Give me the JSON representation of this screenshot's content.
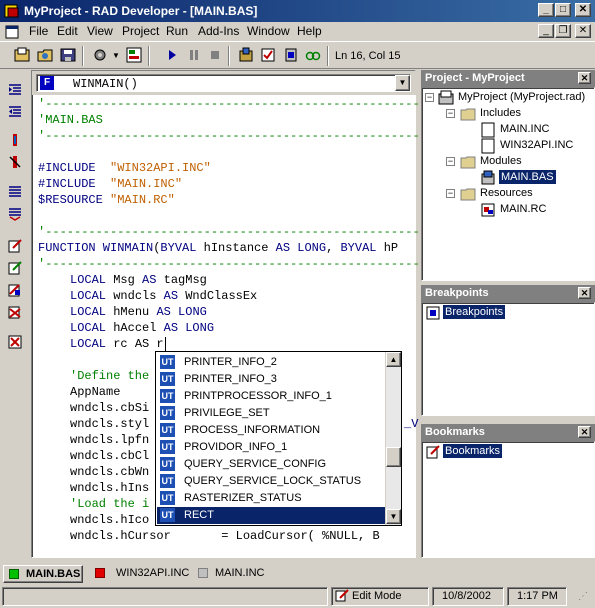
{
  "window": {
    "title": "MyProject - RAD Developer - [MAIN.BAS]"
  },
  "menu": [
    "File",
    "Edit",
    "View",
    "Project",
    "Run",
    "Add-Ins",
    "Window",
    "Help"
  ],
  "toolbar": {
    "position_text": "Ln 16, Col 15"
  },
  "editor": {
    "procedure": "WINMAIN()",
    "dash_line": "'-----------------------------------------------------------------",
    "file_comment": "'MAIN.BAS",
    "includes": [
      {
        "directive": "#INCLUDE",
        "file": "\"WIN32API.INC\""
      },
      {
        "directive": "#INCLUDE",
        "file": "\"MAIN.INC\""
      },
      {
        "directive": "$RESOURCE",
        "file": "\"MAIN.RC\""
      }
    ],
    "function_line": {
      "kw1": "FUNCTION WINMAIN",
      "p1": "(",
      "kw2": "BYVAL",
      "p2": " hInstance ",
      "kw3": "AS LONG",
      "p3": ", ",
      "kw4": "BYVAL",
      "p4": " hP"
    },
    "locals": [
      {
        "kw": "LOCAL",
        "name": " Msg ",
        "as": "AS",
        "type": " tagMsg"
      },
      {
        "kw": "LOCAL",
        "name": " wndcls ",
        "as": "AS",
        "type": " WndClassEx"
      },
      {
        "kw": "LOCAL",
        "name": " hMenu ",
        "as": "AS",
        "type": " LONG"
      },
      {
        "kw": "LOCAL",
        "name": " hAccel ",
        "as": "AS",
        "type": " LONG"
      },
      {
        "kw": "LOCAL",
        "name": " rc AS r",
        "as": "",
        "type": ""
      }
    ],
    "body_lines": [
      {
        "text": "'Define the",
        "cls": "cm"
      },
      {
        "text": "AppName",
        "cls": ""
      },
      {
        "text": "wndcls.cbSi",
        "cls": ""
      },
      {
        "text": "wndcls.styl",
        "cls": ""
      },
      {
        "text": "wndcls.lpfn",
        "cls": ""
      },
      {
        "text": "wndcls.cbCl",
        "cls": ""
      },
      {
        "text": "wndcls.cbWn",
        "cls": ""
      },
      {
        "text": "wndcls.hIns",
        "cls": ""
      },
      {
        "text": "'Load the i",
        "cls": "cm"
      },
      {
        "text": "wndcls.hIco",
        "cls": ""
      },
      {
        "text": "wndcls.hCursor       = LoadCursor( %NULL, B",
        "cls": ""
      }
    ],
    "side_fragment": "_V"
  },
  "autocomplete": {
    "badge": "UT",
    "items": [
      "PRINTER_INFO_2",
      "PRINTER_INFO_3",
      "PRINTPROCESSOR_INFO_1",
      "PRIVILEGE_SET",
      "PROCESS_INFORMATION",
      "PROVIDOR_INFO_1",
      "QUERY_SERVICE_CONFIG",
      "QUERY_SERVICE_LOCK_STATUS",
      "RASTERIZER_STATUS",
      "RECT"
    ],
    "selected_index": 9
  },
  "project_panel": {
    "title": "Project - MyProject",
    "root": "MyProject (MyProject.rad)",
    "includes_label": "Includes",
    "includes": [
      "MAIN.INC",
      "WIN32API.INC"
    ],
    "modules_label": "Modules",
    "modules": [
      "MAIN.BAS"
    ],
    "resources_label": "Resources",
    "resources": [
      "MAIN.RC"
    ]
  },
  "breakpoints_panel": {
    "title": "Breakpoints",
    "item": "Breakpoints"
  },
  "bookmarks_panel": {
    "title": "Bookmarks",
    "item": "Bookmarks"
  },
  "tabs": [
    "MAIN.BAS",
    "WIN32API.INC",
    "MAIN.INC"
  ],
  "status": {
    "mode": "Edit Mode",
    "date": "10/8/2002",
    "time": "1:17 PM"
  },
  "colors": {
    "title_bar": "#0a246a",
    "selection": "#0a246a",
    "keyword": "#000080",
    "comment": "#008000",
    "string": "#c06000"
  }
}
